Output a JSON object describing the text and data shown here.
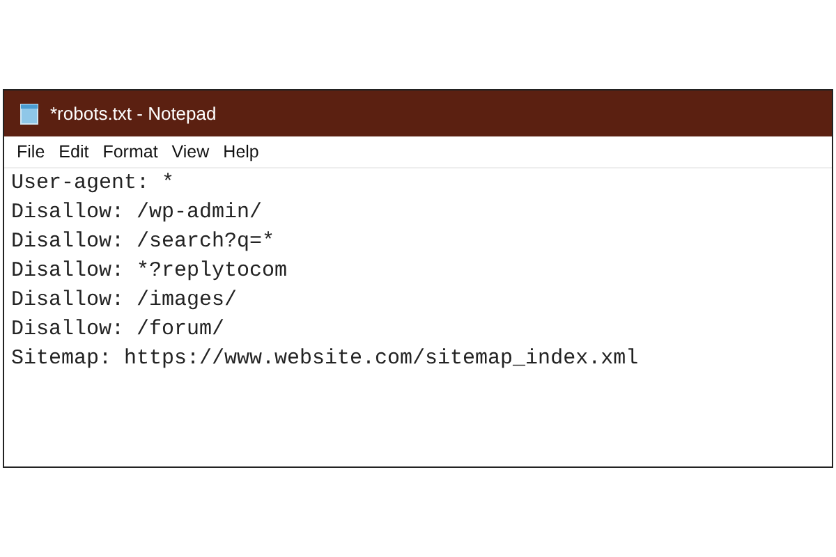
{
  "window": {
    "title": "*robots.txt - Notepad"
  },
  "menu": [
    "File",
    "Edit",
    "Format",
    "View",
    "Help"
  ],
  "editor": {
    "lines": [
      "User-agent: *",
      "Disallow: /wp-admin/",
      "Disallow: /search?q=*",
      "Disallow: *?replytocom",
      "Disallow: /images/",
      "Disallow: /forum/",
      "Sitemap: https://www.website.com/sitemap_index.xml"
    ]
  }
}
